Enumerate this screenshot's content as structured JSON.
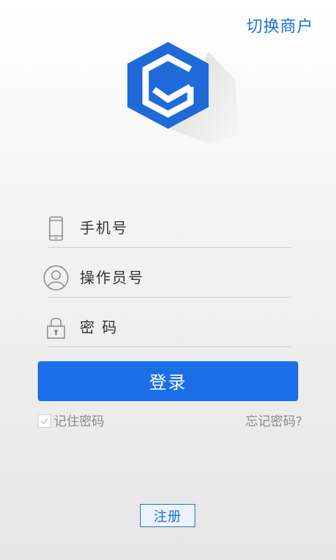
{
  "header": {
    "switch_merchant": "切换商户"
  },
  "form": {
    "phone_placeholder": "手机号",
    "operator_placeholder": "操作员号",
    "password_placeholder": "密 码"
  },
  "actions": {
    "login_label": "登录",
    "remember_label": "记住密码",
    "remember_checked": true,
    "forgot_label": "忘记密码?",
    "register_label": "注册"
  },
  "colors": {
    "accent": "#1a6fe8",
    "logo_blue": "#1f6ad8",
    "muted_text": "#8a8a8a"
  },
  "icons": {
    "logo": "hexagon-logo-icon",
    "phone": "phone-icon",
    "operator": "user-icon",
    "password": "lock-icon",
    "checkbox": "checkmark-icon"
  }
}
